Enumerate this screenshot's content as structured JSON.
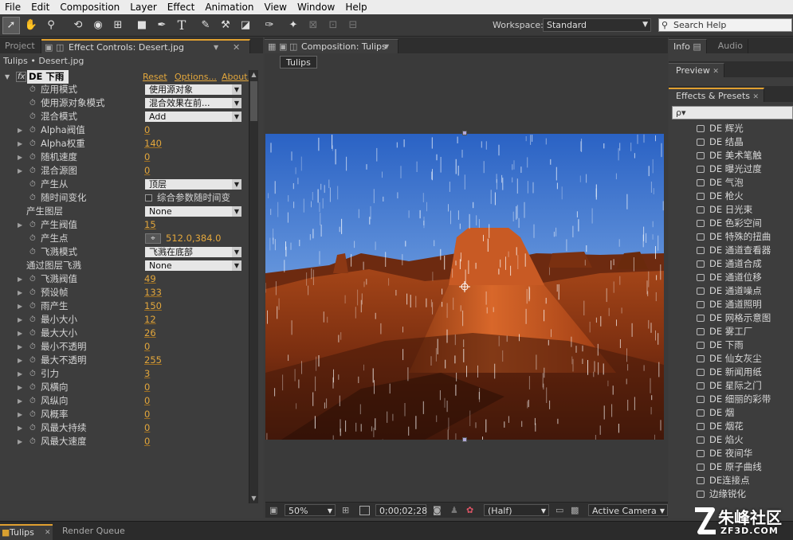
{
  "menu": [
    "File",
    "Edit",
    "Composition",
    "Layer",
    "Effect",
    "Animation",
    "View",
    "Window",
    "Help"
  ],
  "toolbar": {
    "tools": [
      "selection-tool-icon",
      "hand-tool-icon",
      "zoom-tool-icon",
      "rotate-tool-icon",
      "camera-orbit-icon",
      "pan-behind-icon",
      "rectangle-mask-icon",
      "pen-tool-icon",
      "type-tool-icon",
      "brush-tool-icon",
      "clone-stamp-icon",
      "eraser-icon",
      "roto-brush-icon",
      "puppet-pin-icon"
    ],
    "workspace_label": "Workspace:",
    "workspace_value": "Standard",
    "search_placeholder": "Search Help"
  },
  "left_panel": {
    "tabs": [
      "Project",
      "Effect Controls: Desert.jpg"
    ],
    "breadcrumb": "Tulips • Desert.jpg",
    "effect_name": "DE 下雨",
    "links": {
      "reset": "Reset",
      "options": "Options...",
      "about": "About..."
    },
    "params": [
      {
        "label": "应用模式",
        "type": "dropdown",
        "value": "使用源对象",
        "twirl": false,
        "stopwatch": true
      },
      {
        "label": "使用源对象模式",
        "type": "dropdown",
        "value": "混合效果在前...",
        "twirl": false,
        "stopwatch": true
      },
      {
        "label": "混合模式",
        "type": "dropdown",
        "value": "Add",
        "twirl": false,
        "stopwatch": true
      },
      {
        "label": "Alpha阀值",
        "type": "number",
        "value": "0",
        "twirl": true,
        "stopwatch": true
      },
      {
        "label": "Alpha权重",
        "type": "number",
        "value": "140",
        "twirl": true,
        "stopwatch": true
      },
      {
        "label": "随机速度",
        "type": "number",
        "value": "0",
        "twirl": true,
        "stopwatch": true
      },
      {
        "label": "混合源图",
        "type": "number",
        "value": "0",
        "twirl": true,
        "stopwatch": true
      },
      {
        "label": "产生从",
        "type": "dropdown",
        "value": "顶层",
        "twirl": false,
        "stopwatch": true
      },
      {
        "label": "随时间变化",
        "type": "checkbox",
        "value": "综合参数随时间变",
        "twirl": false,
        "stopwatch": true
      },
      {
        "label": "产生图层",
        "type": "dropdown",
        "value": "None",
        "twirl": false,
        "stopwatch": false
      },
      {
        "label": "产生阀值",
        "type": "number",
        "value": "15",
        "twirl": true,
        "stopwatch": true
      },
      {
        "label": "产生点",
        "type": "point",
        "value": "512.0,384.0",
        "twirl": false,
        "stopwatch": true
      },
      {
        "label": "飞溅模式",
        "type": "dropdown",
        "value": "飞溅在底部",
        "twirl": false,
        "stopwatch": true
      },
      {
        "label": "通过图层飞溅",
        "type": "dropdown",
        "value": "None",
        "twirl": false,
        "stopwatch": false
      },
      {
        "label": "飞溅阀值",
        "type": "number",
        "value": "49",
        "twirl": true,
        "stopwatch": true
      },
      {
        "label": "预设帧",
        "type": "number",
        "value": "133",
        "twirl": true,
        "stopwatch": true
      },
      {
        "label": "雨产生",
        "type": "number",
        "value": "150",
        "twirl": true,
        "stopwatch": true
      },
      {
        "label": "最小大小",
        "type": "number",
        "value": "12",
        "twirl": true,
        "stopwatch": true
      },
      {
        "label": "最大大小",
        "type": "number",
        "value": "26",
        "twirl": true,
        "stopwatch": true
      },
      {
        "label": "最小不透明",
        "type": "number",
        "value": "0",
        "twirl": true,
        "stopwatch": true
      },
      {
        "label": "最大不透明",
        "type": "number",
        "value": "255",
        "twirl": true,
        "stopwatch": true
      },
      {
        "label": "引力",
        "type": "number",
        "value": "3",
        "twirl": true,
        "stopwatch": true
      },
      {
        "label": "风横向",
        "type": "number",
        "value": "0",
        "twirl": true,
        "stopwatch": true
      },
      {
        "label": "风纵向",
        "type": "number",
        "value": "0",
        "twirl": true,
        "stopwatch": true
      },
      {
        "label": "风概率",
        "type": "number",
        "value": "0",
        "twirl": true,
        "stopwatch": true
      },
      {
        "label": "风最大持续",
        "type": "number",
        "value": "0",
        "twirl": true,
        "stopwatch": true
      },
      {
        "label": "风最大速度",
        "type": "number",
        "value": "0",
        "twirl": true,
        "stopwatch": true
      }
    ]
  },
  "comp": {
    "tab": "Composition: Tulips",
    "layer_tab": "Tulips",
    "zoom": "50%",
    "timecode": "0;00;02;28",
    "resolution": "(Half)",
    "camera": "Active Camera"
  },
  "right_panel": {
    "tabs_top": [
      "Info",
      "Audio"
    ],
    "preview_tab": "Preview",
    "effects_tab": "Effects & Presets",
    "search_icon_label": "ρ▾",
    "presets": [
      "DE 辉光",
      "DE 结晶",
      "DE 美术笔触",
      "DE 曝光过度",
      "DE 气泡",
      "DE 枪火",
      "DE 日光束",
      "DE 色彩空间",
      "DE 特殊的扭曲",
      "DE 通道查看器",
      "DE 通道合成",
      "DE 通道位移",
      "DE 通道噪点",
      "DE 通道照明",
      "DE 网格示意图",
      "DE 雾工厂",
      "DE 下雨",
      "DE 仙女灰尘",
      "DE 新闻用纸",
      "DE 星际之门",
      "DE 细丽的彩带",
      "DE 烟",
      "DE 烟花",
      "DE 焰火",
      "DE 夜间华",
      "DE 原子曲线",
      "DE连接点",
      "边缘锐化"
    ]
  },
  "bottom": {
    "tabs": [
      "Tulips",
      "Render Queue"
    ]
  },
  "watermark": {
    "text": "朱峰社区",
    "sub": "ZF3D.COM"
  },
  "colors": {
    "accent": "#e3a73c",
    "panel": "#3d3d3d",
    "menubar": "#ececec"
  }
}
